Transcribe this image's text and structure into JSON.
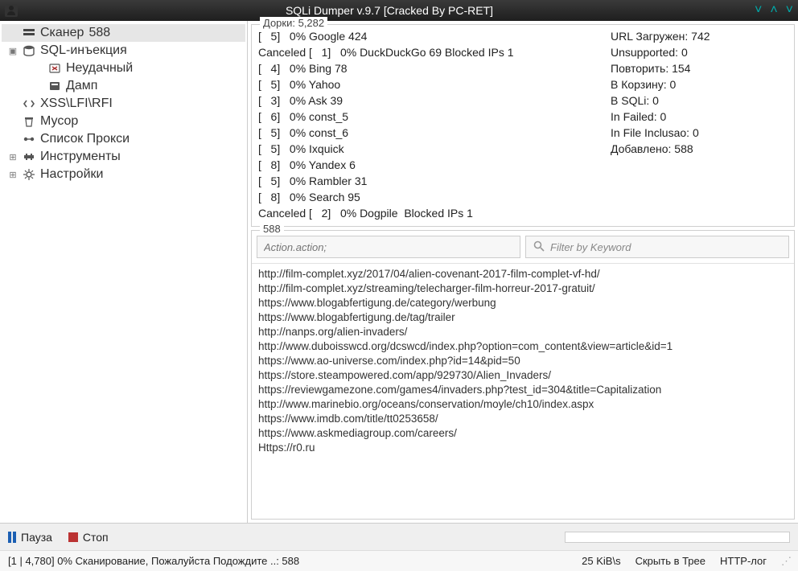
{
  "window": {
    "title": "SQLi Dumper v.9.7 [Cracked By PC-RET]"
  },
  "tree": {
    "scanner": {
      "label": "Сканер",
      "count": "588"
    },
    "sqli": {
      "label": "SQL-инъекция"
    },
    "failed": {
      "label": "Неудачный"
    },
    "dump": {
      "label": "Дамп"
    },
    "xss": {
      "label": "XSS\\LFI\\RFI"
    },
    "trash": {
      "label": "Мусор"
    },
    "proxy": {
      "label": "Список Прокси"
    },
    "tools": {
      "label": "Инструменты"
    },
    "settings": {
      "label": "Настройки"
    }
  },
  "engines": {
    "legend": "Дорки:  5,282",
    "lines": [
      "[   5]   0% Google 424",
      "Canceled [   1]   0% DuckDuckGo 69 Blocked IPs 1",
      "[   4]   0% Bing 78",
      "[   5]   0% Yahoo",
      "[   3]   0% Ask 39",
      "[   6]   0% const_5",
      "[   5]   0% const_6",
      "[   5]   0% Ixquick",
      "[   8]   0% Yandex 6",
      "[   5]   0% Rambler 31",
      "[   8]   0% Search 95",
      "Canceled [   2]   0% Dogpile  Blocked IPs 1"
    ],
    "stats": [
      "URL Загружен:  742",
      "Unsupported:  0",
      "Повторить:  154",
      "В Корзину:  0",
      "В SQLi:  0",
      "In Failed:  0",
      "In File Inclusao:  0",
      "Добавлено:  588"
    ]
  },
  "results": {
    "legend": "588",
    "action_placeholder": "Action.action;",
    "filter_placeholder": "Filter by Keyword",
    "urls": [
      "http://film-complet.xyz/2017/04/alien-covenant-2017-film-complet-vf-hd/",
      "http://film-complet.xyz/streaming/telecharger-film-horreur-2017-gratuit/",
      "https://www.blogabfertigung.de/category/werbung",
      "https://www.blogabfertigung.de/tag/trailer",
      "http://nanps.org/alien-invaders/",
      "http://www.duboisswcd.org/dcswcd/index.php?option=com_content&view=article&id=1",
      "https://www.ao-universe.com/index.php?id=14&pid=50",
      "https://store.steampowered.com/app/929730/Alien_Invaders/",
      "https://reviewgamezone.com/games4/invaders.php?test_id=304&title=Capitalization",
      "http://www.marinebio.org/oceans/conservation/moyle/ch10/index.aspx",
      "https://www.imdb.com/title/tt0253658/",
      "https://www.askmediagroup.com/careers/",
      "Https://r0.ru"
    ]
  },
  "controls": {
    "pause": "Пауза",
    "stop": "Стоп"
  },
  "status": {
    "left": "[1 | 4,780] 0% Сканирование, Пожалуйста Подождите ..: 588",
    "speed": "25 KiB\\s",
    "hide_tree": "Скрыть в Трее",
    "http_log": "HTTP-лог"
  }
}
